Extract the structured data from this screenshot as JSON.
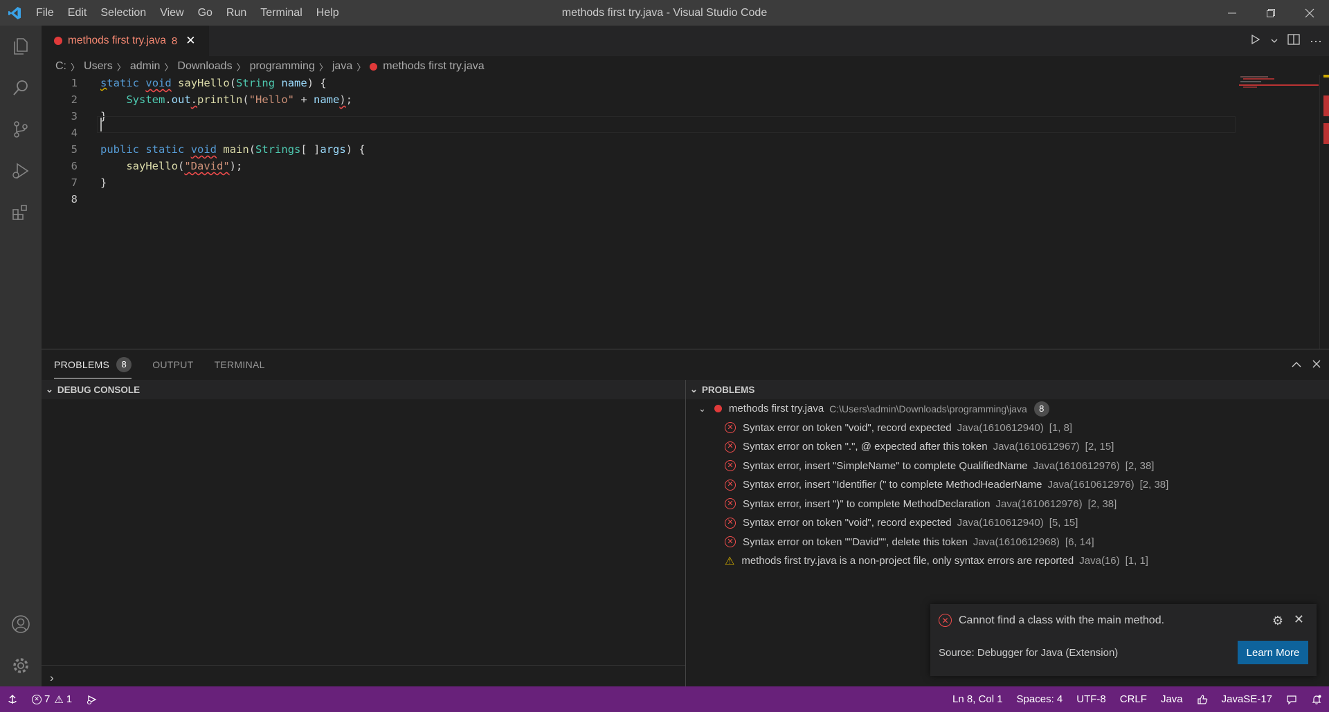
{
  "window": {
    "title": "methods first try.java - Visual Studio Code",
    "menu": [
      "File",
      "Edit",
      "Selection",
      "View",
      "Go",
      "Run",
      "Terminal",
      "Help"
    ]
  },
  "activity_bar": {
    "items": [
      "explorer-icon",
      "search-icon",
      "source-control-icon",
      "run-debug-icon",
      "extensions-icon"
    ],
    "bottom": [
      "accounts-icon",
      "manage-gear-icon"
    ]
  },
  "editor": {
    "tab": {
      "label": "methods first try.java",
      "problem_count": "8"
    },
    "breadcrumb": [
      "C:",
      "Users",
      "admin",
      "Downloads",
      "programming",
      "java",
      "methods first try.java"
    ],
    "line_numbers": [
      "1",
      "2",
      "3",
      "4",
      "5",
      "6",
      "7",
      "8"
    ],
    "cursor_line": "8"
  },
  "panel": {
    "tabs": {
      "problems": "PROBLEMS",
      "problems_count": "8",
      "output": "OUTPUT",
      "terminal": "TERMINAL"
    },
    "debug_console_title": "DEBUG CONSOLE",
    "problems_title": "PROBLEMS",
    "file": {
      "name": "methods first try.java",
      "path": "C:\\Users\\admin\\Downloads\\programming\\java",
      "count": "8"
    },
    "problems": [
      {
        "severity": "error",
        "message": "Syntax error on token \"void\", record expected",
        "code": "Java(1610612940)",
        "pos": "[1, 8]"
      },
      {
        "severity": "error",
        "message": "Syntax error on token \".\", @ expected after this token",
        "code": "Java(1610612967)",
        "pos": "[2, 15]"
      },
      {
        "severity": "error",
        "message": "Syntax error, insert \"SimpleName\" to complete QualifiedName",
        "code": "Java(1610612976)",
        "pos": "[2, 38]"
      },
      {
        "severity": "error",
        "message": "Syntax error, insert \"Identifier (\" to complete MethodHeaderName",
        "code": "Java(1610612976)",
        "pos": "[2, 38]"
      },
      {
        "severity": "error",
        "message": "Syntax error, insert \")\" to complete MethodDeclaration",
        "code": "Java(1610612976)",
        "pos": "[2, 38]"
      },
      {
        "severity": "error",
        "message": "Syntax error on token \"void\", record expected",
        "code": "Java(1610612940)",
        "pos": "[5, 15]"
      },
      {
        "severity": "error",
        "message": "Syntax error on token \"\"David\"\", delete this token",
        "code": "Java(1610612968)",
        "pos": "[6, 14]"
      },
      {
        "severity": "warning",
        "message": "methods first try.java is a non-project file, only syntax errors are reported",
        "code": "Java(16)",
        "pos": "[1, 1]"
      }
    ]
  },
  "notification": {
    "message": "Cannot find a class with the main method.",
    "source": "Source: Debugger for Java (Extension)",
    "button": "Learn More"
  },
  "statusbar": {
    "errors": "7",
    "warnings": "1",
    "position": "Ln 8, Col 1",
    "spaces": "Spaces: 4",
    "encoding": "UTF-8",
    "eol": "CRLF",
    "language": "Java",
    "runtime": "JavaSE-17"
  },
  "colors": {
    "statusbar": "#68217a",
    "error": "#f14c4c",
    "warning": "#cca700",
    "button": "#0e639c"
  }
}
